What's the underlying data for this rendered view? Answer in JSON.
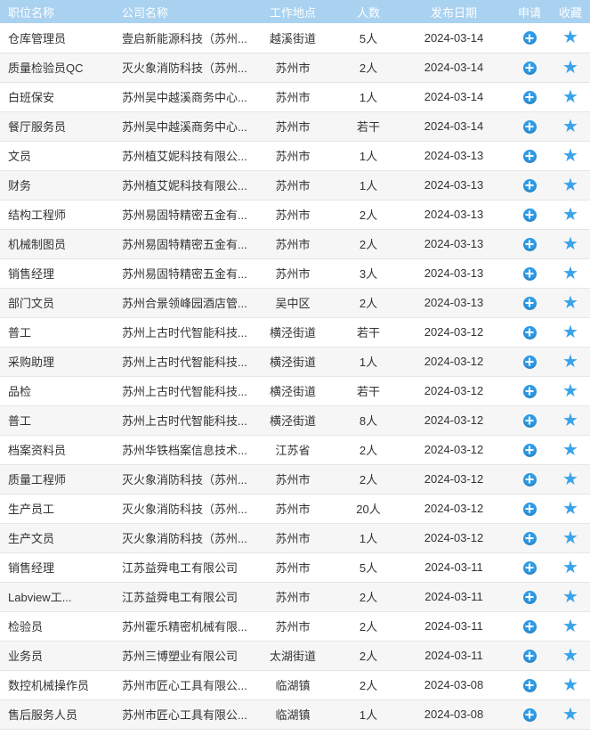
{
  "headers": {
    "title": "职位名称",
    "company": "公司名称",
    "location": "工作地点",
    "count": "人数",
    "date": "发布日期",
    "apply": "申请",
    "favorite": "收藏"
  },
  "icons": {
    "apply": "plus-circle-icon",
    "favorite": "star-icon"
  },
  "colors": {
    "header_bg": "#a9d2f0",
    "icon_blue": "#2f9be6"
  },
  "rows": [
    {
      "title": "仓库管理员",
      "company": "壹启新能源科技（苏州...",
      "location": "越溪街道",
      "count": "5人",
      "date": "2024-03-14"
    },
    {
      "title": "质量检验员QC",
      "company": "灭火象消防科技（苏州...",
      "location": "苏州市",
      "count": "2人",
      "date": "2024-03-14"
    },
    {
      "title": "白班保安",
      "company": "苏州吴中越溪商务中心...",
      "location": "苏州市",
      "count": "1人",
      "date": "2024-03-14"
    },
    {
      "title": "餐厅服务员",
      "company": "苏州吴中越溪商务中心...",
      "location": "苏州市",
      "count": "若干",
      "date": "2024-03-14"
    },
    {
      "title": "文员",
      "company": "苏州植艾妮科技有限公...",
      "location": "苏州市",
      "count": "1人",
      "date": "2024-03-13"
    },
    {
      "title": "财务",
      "company": "苏州植艾妮科技有限公...",
      "location": "苏州市",
      "count": "1人",
      "date": "2024-03-13"
    },
    {
      "title": "结构工程师",
      "company": "苏州易固特精密五金有...",
      "location": "苏州市",
      "count": "2人",
      "date": "2024-03-13"
    },
    {
      "title": "机械制图员",
      "company": "苏州易固特精密五金有...",
      "location": "苏州市",
      "count": "2人",
      "date": "2024-03-13"
    },
    {
      "title": "销售经理",
      "company": "苏州易固特精密五金有...",
      "location": "苏州市",
      "count": "3人",
      "date": "2024-03-13"
    },
    {
      "title": "部门文员",
      "company": "苏州合景领峰园酒店管...",
      "location": "吴中区",
      "count": "2人",
      "date": "2024-03-13"
    },
    {
      "title": "普工",
      "company": "苏州上古时代智能科技...",
      "location": "横泾街道",
      "count": "若干",
      "date": "2024-03-12"
    },
    {
      "title": "采购助理",
      "company": "苏州上古时代智能科技...",
      "location": "横泾街道",
      "count": "1人",
      "date": "2024-03-12"
    },
    {
      "title": "品检",
      "company": "苏州上古时代智能科技...",
      "location": "横泾街道",
      "count": "若干",
      "date": "2024-03-12"
    },
    {
      "title": "普工",
      "company": "苏州上古时代智能科技...",
      "location": "横泾街道",
      "count": "8人",
      "date": "2024-03-12"
    },
    {
      "title": "档案资料员",
      "company": "苏州华铁档案信息技术...",
      "location": "江苏省",
      "count": "2人",
      "date": "2024-03-12"
    },
    {
      "title": "质量工程师",
      "company": "灭火象消防科技（苏州...",
      "location": "苏州市",
      "count": "2人",
      "date": "2024-03-12"
    },
    {
      "title": "生产员工",
      "company": "灭火象消防科技（苏州...",
      "location": "苏州市",
      "count": "20人",
      "date": "2024-03-12"
    },
    {
      "title": "生产文员",
      "company": "灭火象消防科技（苏州...",
      "location": "苏州市",
      "count": "1人",
      "date": "2024-03-12"
    },
    {
      "title": "销售经理",
      "company": "江苏益舜电工有限公司",
      "location": "苏州市",
      "count": "5人",
      "date": "2024-03-11"
    },
    {
      "title": "Labview工...",
      "company": "江苏益舜电工有限公司",
      "location": "苏州市",
      "count": "2人",
      "date": "2024-03-11"
    },
    {
      "title": "检验员",
      "company": "苏州霍乐精密机械有限...",
      "location": "苏州市",
      "count": "2人",
      "date": "2024-03-11"
    },
    {
      "title": "业务员",
      "company": "苏州三博塑业有限公司",
      "location": "太湖街道",
      "count": "2人",
      "date": "2024-03-11"
    },
    {
      "title": "数控机械操作员",
      "company": "苏州市匠心工具有限公...",
      "location": "临湖镇",
      "count": "2人",
      "date": "2024-03-08"
    },
    {
      "title": "售后服务人员",
      "company": "苏州市匠心工具有限公...",
      "location": "临湖镇",
      "count": "1人",
      "date": "2024-03-08"
    }
  ]
}
